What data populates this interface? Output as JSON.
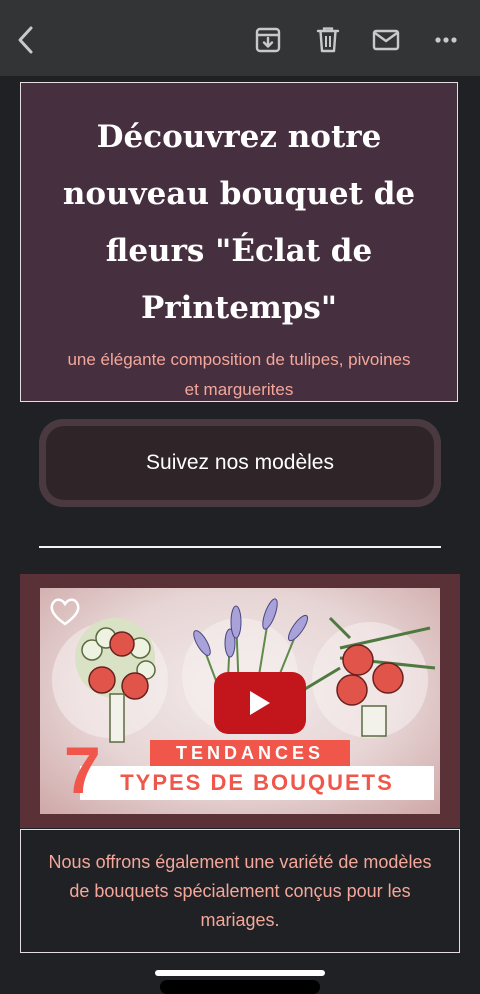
{
  "toolbar": {
    "back_icon": "chevron-left-icon",
    "archive_icon": "archive-icon",
    "delete_icon": "trash-icon",
    "mark_unread_icon": "envelope-icon",
    "more_icon": "more-horizontal-icon"
  },
  "hero": {
    "title": "Découvrez notre nouveau bouquet de fleurs \"Éclat de Printemps\"",
    "subtitle": "une élégante composition de tulipes, pivoines et marguerites"
  },
  "cta": {
    "label": "Suivez nos modèles"
  },
  "video": {
    "line1": "TENDANCES",
    "number": "7",
    "line2": "TYPES DE BOUQUETS",
    "play_icon": "play-icon",
    "heart_icon": "heart-outline-icon"
  },
  "info": {
    "text": "Nous offrons également une variété de modèles de bouquets spécialement conçus pour les mariages."
  },
  "colors": {
    "hero_bg": "#462f3f",
    "accent_text": "#f4a79a",
    "play_red": "#c3161c",
    "banner_coral": "#f0564a"
  }
}
